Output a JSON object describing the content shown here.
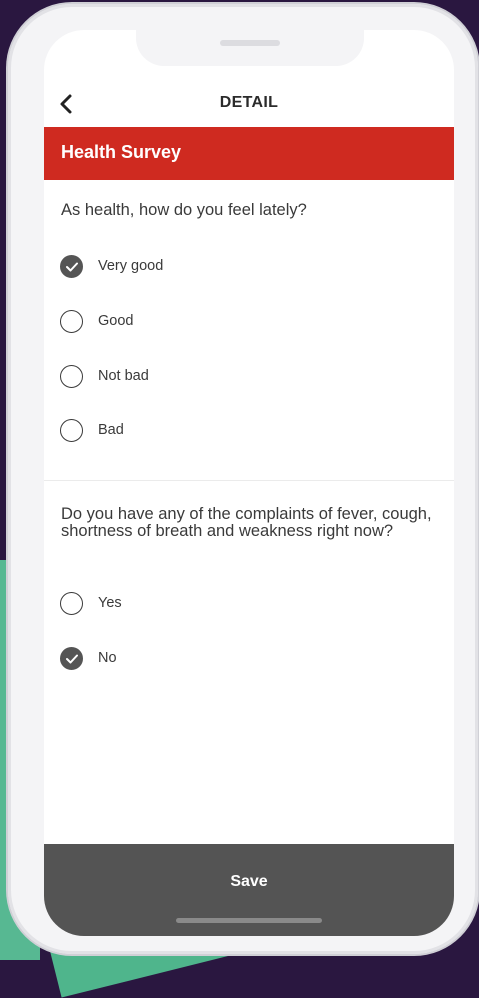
{
  "header": {
    "title": "DETAIL"
  },
  "banner": {
    "title": "Health Survey"
  },
  "q1": {
    "text": "As health, how do you feel lately?",
    "options": [
      {
        "label": "Very good",
        "checked": true
      },
      {
        "label": "Good",
        "checked": false
      },
      {
        "label": "Not bad",
        "checked": false
      },
      {
        "label": "Bad",
        "checked": false
      }
    ]
  },
  "q2": {
    "text": "Do you have any of the complaints of fever, cough, shortness of breath and weakness right now?",
    "options": [
      {
        "label": "Yes",
        "checked": false
      },
      {
        "label": "No",
        "checked": true
      }
    ]
  },
  "footer": {
    "save_label": "Save"
  },
  "colors": {
    "accent": "#cf2a20",
    "save_bg": "#545454",
    "selected": "#555555"
  }
}
